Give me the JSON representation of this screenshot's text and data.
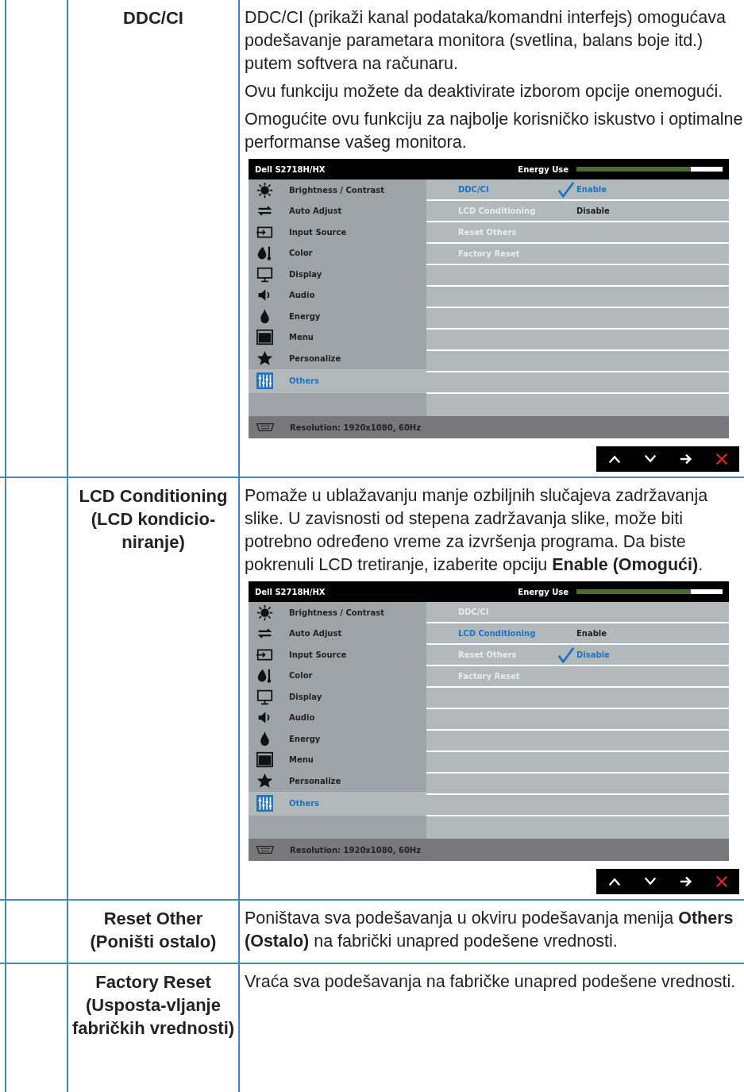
{
  "rows": [
    {
      "heading": "DDC/CI",
      "paragraphs": [
        "DDC/CI (prikaži kanal podataka/komandni interfejs) omogućava podešavanje parametara monitora (svetlina, balans boje itd.) putem softvera na računaru.",
        "Ovu funkciju možete da deaktivirate izborom opcije onemogući.",
        "Omogućite ovu funkciju za najbolje korisničko iskustvo i optimalne performanse vašeg monitora."
      ],
      "osd": {
        "model": "Dell S2718H/HX",
        "energy_label": "Energy Use",
        "energy": {
          "level": 0.78
        },
        "menu": [
          {
            "label": "Brightness / Contrast",
            "selected": false
          },
          {
            "label": "Auto Adjust",
            "selected": false
          },
          {
            "label": "Input Source",
            "selected": false
          },
          {
            "label": "Color",
            "selected": false
          },
          {
            "label": "Display",
            "selected": false
          },
          {
            "label": "Audio",
            "selected": false
          },
          {
            "label": "Energy",
            "selected": false
          },
          {
            "label": "Menu",
            "selected": false
          },
          {
            "label": "Personalize",
            "selected": false
          },
          {
            "label": "Others",
            "selected": true
          }
        ],
        "submenu": [
          {
            "label": "DDC/CI",
            "selected": true,
            "option": {
              "label": "Enable",
              "checked": true
            }
          },
          {
            "label": "LCD Conditioning",
            "selected": false,
            "option": {
              "label": "Disable",
              "checked": false
            }
          },
          {
            "label": "Reset Others",
            "selected": false
          },
          {
            "label": "Factory Reset",
            "selected": false
          }
        ],
        "footer": "Resolution: 1920x1080, 60Hz"
      }
    },
    {
      "heading": "LCD Conditioning (LCD kondicio-niranje)",
      "paragraphs": [
        "Pomaže u ublažavanju manje ozbiljnih slučajeva zadržavanja slike. U zavisnosti od stepena zadržavanja slike, može biti potrebno određeno vreme za izvršenja programa. Da biste pokrenuli LCD tretiranje, izaberite opciju **Enable (Omogući)**."
      ],
      "osd": {
        "model": "Dell S2718H/HX",
        "energy_label": "Energy Use",
        "energy": {
          "level": 0.78
        },
        "menu": [
          {
            "label": "Brightness / Contrast",
            "selected": false
          },
          {
            "label": "Auto Adjust",
            "selected": false
          },
          {
            "label": "Input Source",
            "selected": false
          },
          {
            "label": "Color",
            "selected": false
          },
          {
            "label": "Display",
            "selected": false
          },
          {
            "label": "Audio",
            "selected": false
          },
          {
            "label": "Energy",
            "selected": false
          },
          {
            "label": "Menu",
            "selected": false
          },
          {
            "label": "Personalize",
            "selected": false
          },
          {
            "label": "Others",
            "selected": true
          }
        ],
        "submenu": [
          {
            "label": "DDC/CI",
            "selected": false
          },
          {
            "label": "LCD Conditioning",
            "selected": true,
            "option": {
              "label": "Enable",
              "checked": false
            }
          },
          {
            "label": "Reset Others",
            "selected": false,
            "option": {
              "label": "Disable",
              "checked": true
            }
          },
          {
            "label": "Factory Reset",
            "selected": false
          }
        ],
        "footer": "Resolution: 1920x1080, 60Hz"
      }
    },
    {
      "heading": "Reset Other (Poništi ostalo)",
      "paragraphs": [
        "Poništava sva podešavanja u okviru podešavanja menija **Others (Ostalo)** na fabrički unapred podešene vrednosti."
      ]
    },
    {
      "heading": "Factory Reset (Usposta-vljanje fabričkih vrednosti)",
      "paragraphs": [
        "Vraća sva podešavanja na fabričke unapred podešene vrednosti."
      ]
    }
  ]
}
